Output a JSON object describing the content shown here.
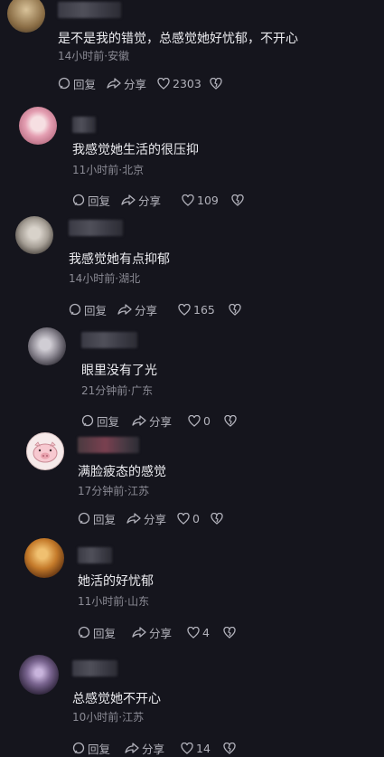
{
  "comments": [
    {
      "text": "是不是我的错觉，总感觉她好忧郁，不开心",
      "meta": "14小时前·安徽",
      "reply": "回复",
      "share": "分享",
      "likes": "2303",
      "avatar_color": "#b49a72"
    },
    {
      "text": "我感觉她生活的很压抑",
      "meta": "11小时前·北京",
      "reply": "回复",
      "share": "分享",
      "likes": "109",
      "avatar_color": "#e8a7b8"
    },
    {
      "text": "我感觉她有点抑郁",
      "meta": "14小时前·湖北",
      "reply": "回复",
      "share": "分享",
      "likes": "165",
      "avatar_color": "#b8b2aa"
    },
    {
      "text": "眼里没有了光",
      "meta": "21分钟前·广东",
      "reply": "回复",
      "share": "分享",
      "likes": "0",
      "avatar_color": "#8c8c96"
    },
    {
      "text": "满脸疲态的感觉",
      "meta": "17分钟前·江苏",
      "reply": "回复",
      "share": "分享",
      "likes": "0",
      "avatar_color": "#f4e6e6"
    },
    {
      "text": "她活的好忧郁",
      "meta": "11小时前·山东",
      "reply": "回复",
      "share": "分享",
      "likes": "4",
      "avatar_color": "#d08a3a"
    },
    {
      "text": "总感觉她不开心",
      "meta": "10小时前·江苏",
      "reply": "回复",
      "share": "分享",
      "likes": "14",
      "avatar_color": "#7a6f8a"
    }
  ]
}
